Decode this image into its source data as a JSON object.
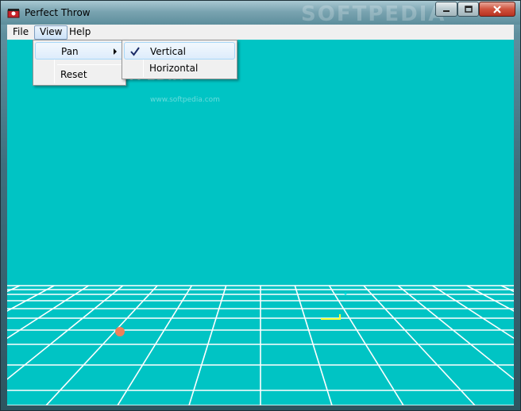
{
  "window": {
    "title": "Perfect Throw",
    "icon": "app-icon",
    "watermark": "SOFTPEDIA",
    "controls": [
      "minimize-icon",
      "maximize-icon",
      "close-icon"
    ]
  },
  "menubar": {
    "file": "File",
    "view": "View",
    "help": "Help"
  },
  "view_menu": {
    "items": [
      {
        "label": "Pan",
        "has_submenu": true,
        "highlighted": true
      },
      {
        "label": "Reset",
        "has_submenu": false
      }
    ]
  },
  "pan_submenu": {
    "items": [
      {
        "label": "Vertical",
        "checked": true,
        "highlighted": true
      },
      {
        "label": "Horizontal",
        "checked": false
      }
    ]
  },
  "scene": {
    "background": "#00c4c4",
    "grid_color": "#ffffff",
    "ball_color": "#f0805a",
    "target_color": "#ffff33",
    "watermark": "SOFTPEDIA",
    "watermark_small": "www.softpedia.com"
  }
}
